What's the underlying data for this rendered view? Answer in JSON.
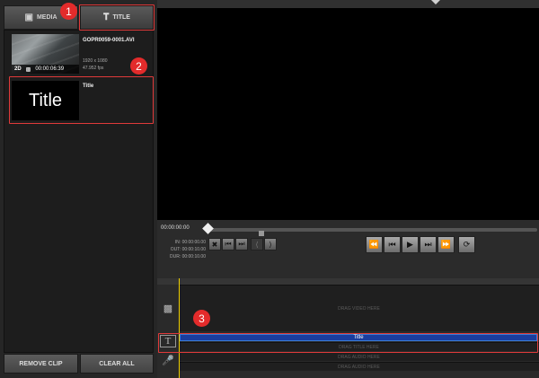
{
  "tabs": {
    "media_label": "MEDIA",
    "title_label": "TITLE"
  },
  "clips": [
    {
      "name": "GOPR0059-0001.AVI",
      "mode": "2D",
      "duration": "00:00:06:39",
      "resolution": "1920 x 1080",
      "fps": "47.952 fps"
    },
    {
      "name": "Title",
      "thumb_text": "Title"
    }
  ],
  "left_buttons": {
    "remove": "REMOVE CLIP",
    "clear": "CLEAR ALL"
  },
  "transport": {
    "timecode": "00:00:00:00",
    "in": "IN: 00:00:00.00",
    "out": "OUT: 00:00:10.00",
    "dur": "DUR: 00:00:10.00"
  },
  "timeline": {
    "video_drop": "DRAG VIDEO HERE",
    "title_clip": "Title",
    "title_drop": "DRAG TITLE HERE",
    "audio_drop_1": "DRAG AUDIO HERE",
    "audio_drop_2": "DRAG AUDIO HERE"
  },
  "callouts": [
    "1",
    "2",
    "3"
  ],
  "colors": {
    "highlight": "#e03a3a",
    "badge": "#e32b2b",
    "title_clip": "#1a3d9e",
    "playhead": "#f0d000"
  },
  "icons": {
    "media_tab": "film-camera-icon",
    "title_tab": "title-text-icon",
    "video_track": "camera-icon",
    "title_track": "text-t-icon",
    "audio_track": "microphone-icon"
  }
}
